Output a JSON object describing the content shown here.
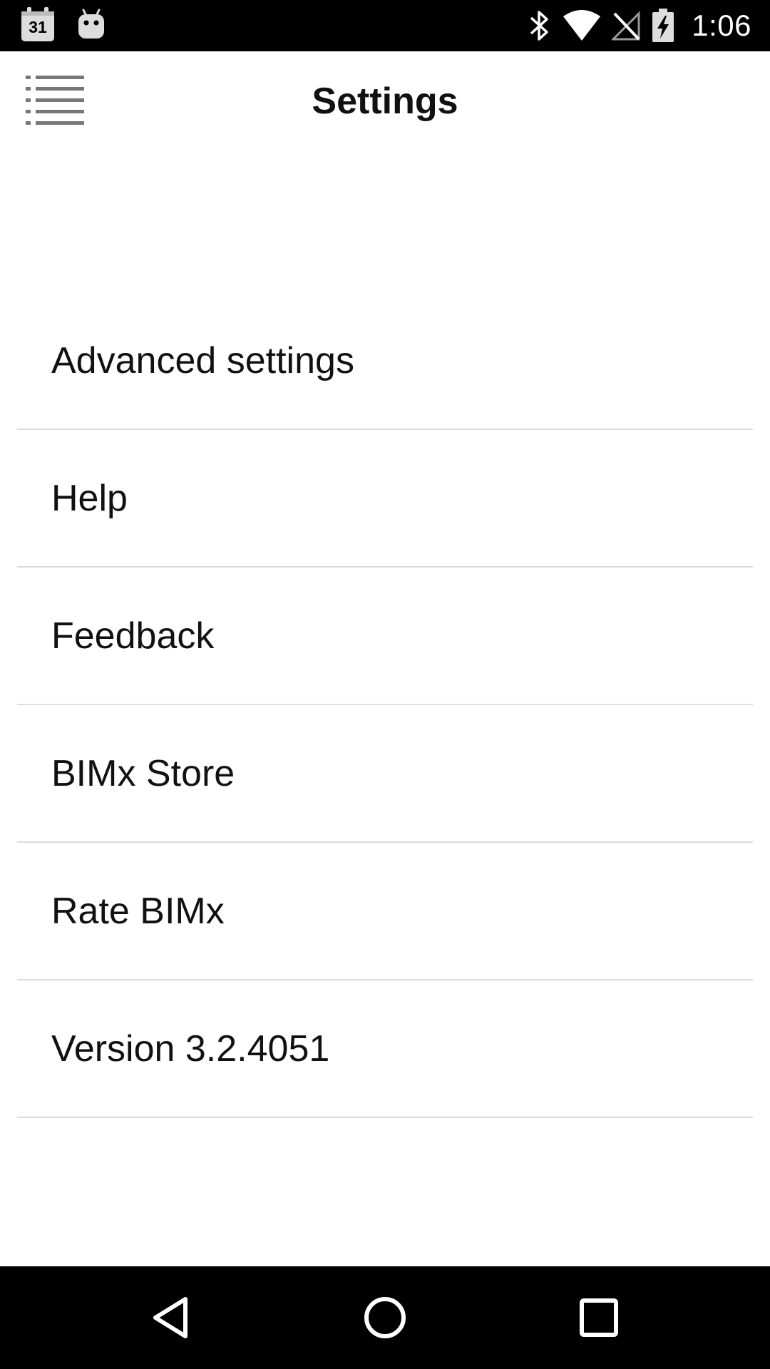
{
  "status_bar": {
    "calendar_day": "31",
    "time": "1:06",
    "icons": [
      "calendar-icon",
      "android-icon",
      "bluetooth-icon",
      "wifi-icon",
      "no-signal-icon",
      "battery-charging-icon"
    ]
  },
  "header": {
    "title": "Settings",
    "menu_icon": "list-menu-icon"
  },
  "settings": {
    "items": [
      {
        "label": "Advanced settings"
      },
      {
        "label": "Help"
      },
      {
        "label": "Feedback"
      },
      {
        "label": "BIMx Store"
      },
      {
        "label": "Rate BIMx"
      },
      {
        "label": "Version 3.2.4051"
      }
    ]
  },
  "nav_bar": {
    "icons": [
      "back-icon",
      "home-icon",
      "recents-icon"
    ]
  },
  "colors": {
    "status_bar_bg": "#000000",
    "app_bg": "#ffffff",
    "text": "#111111",
    "divider": "#dcdcdc",
    "menu_icon": "#777777"
  }
}
